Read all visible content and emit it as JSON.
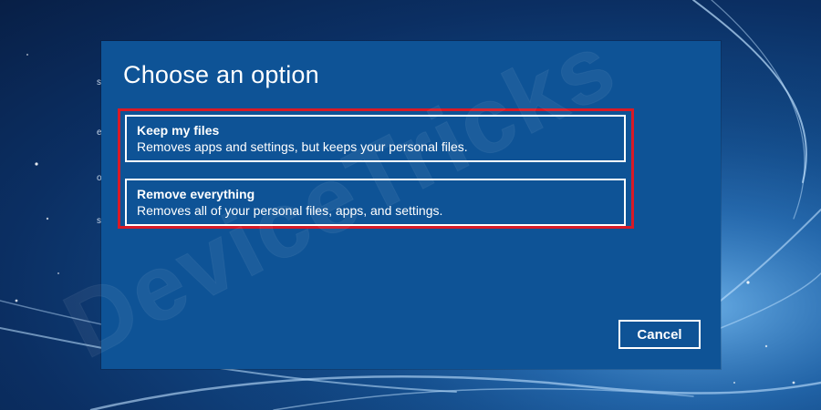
{
  "dialog": {
    "title": "Choose an option",
    "options": [
      {
        "title": "Keep my files",
        "description": "Removes apps and settings, but keeps your personal files."
      },
      {
        "title": "Remove everything",
        "description": "Removes all of your personal files, apps, and settings."
      }
    ],
    "cancel_label": "Cancel",
    "highlight_color": "#d81a26",
    "background_color": "#0e5396"
  },
  "watermark": {
    "text": "DeviceTricks"
  }
}
